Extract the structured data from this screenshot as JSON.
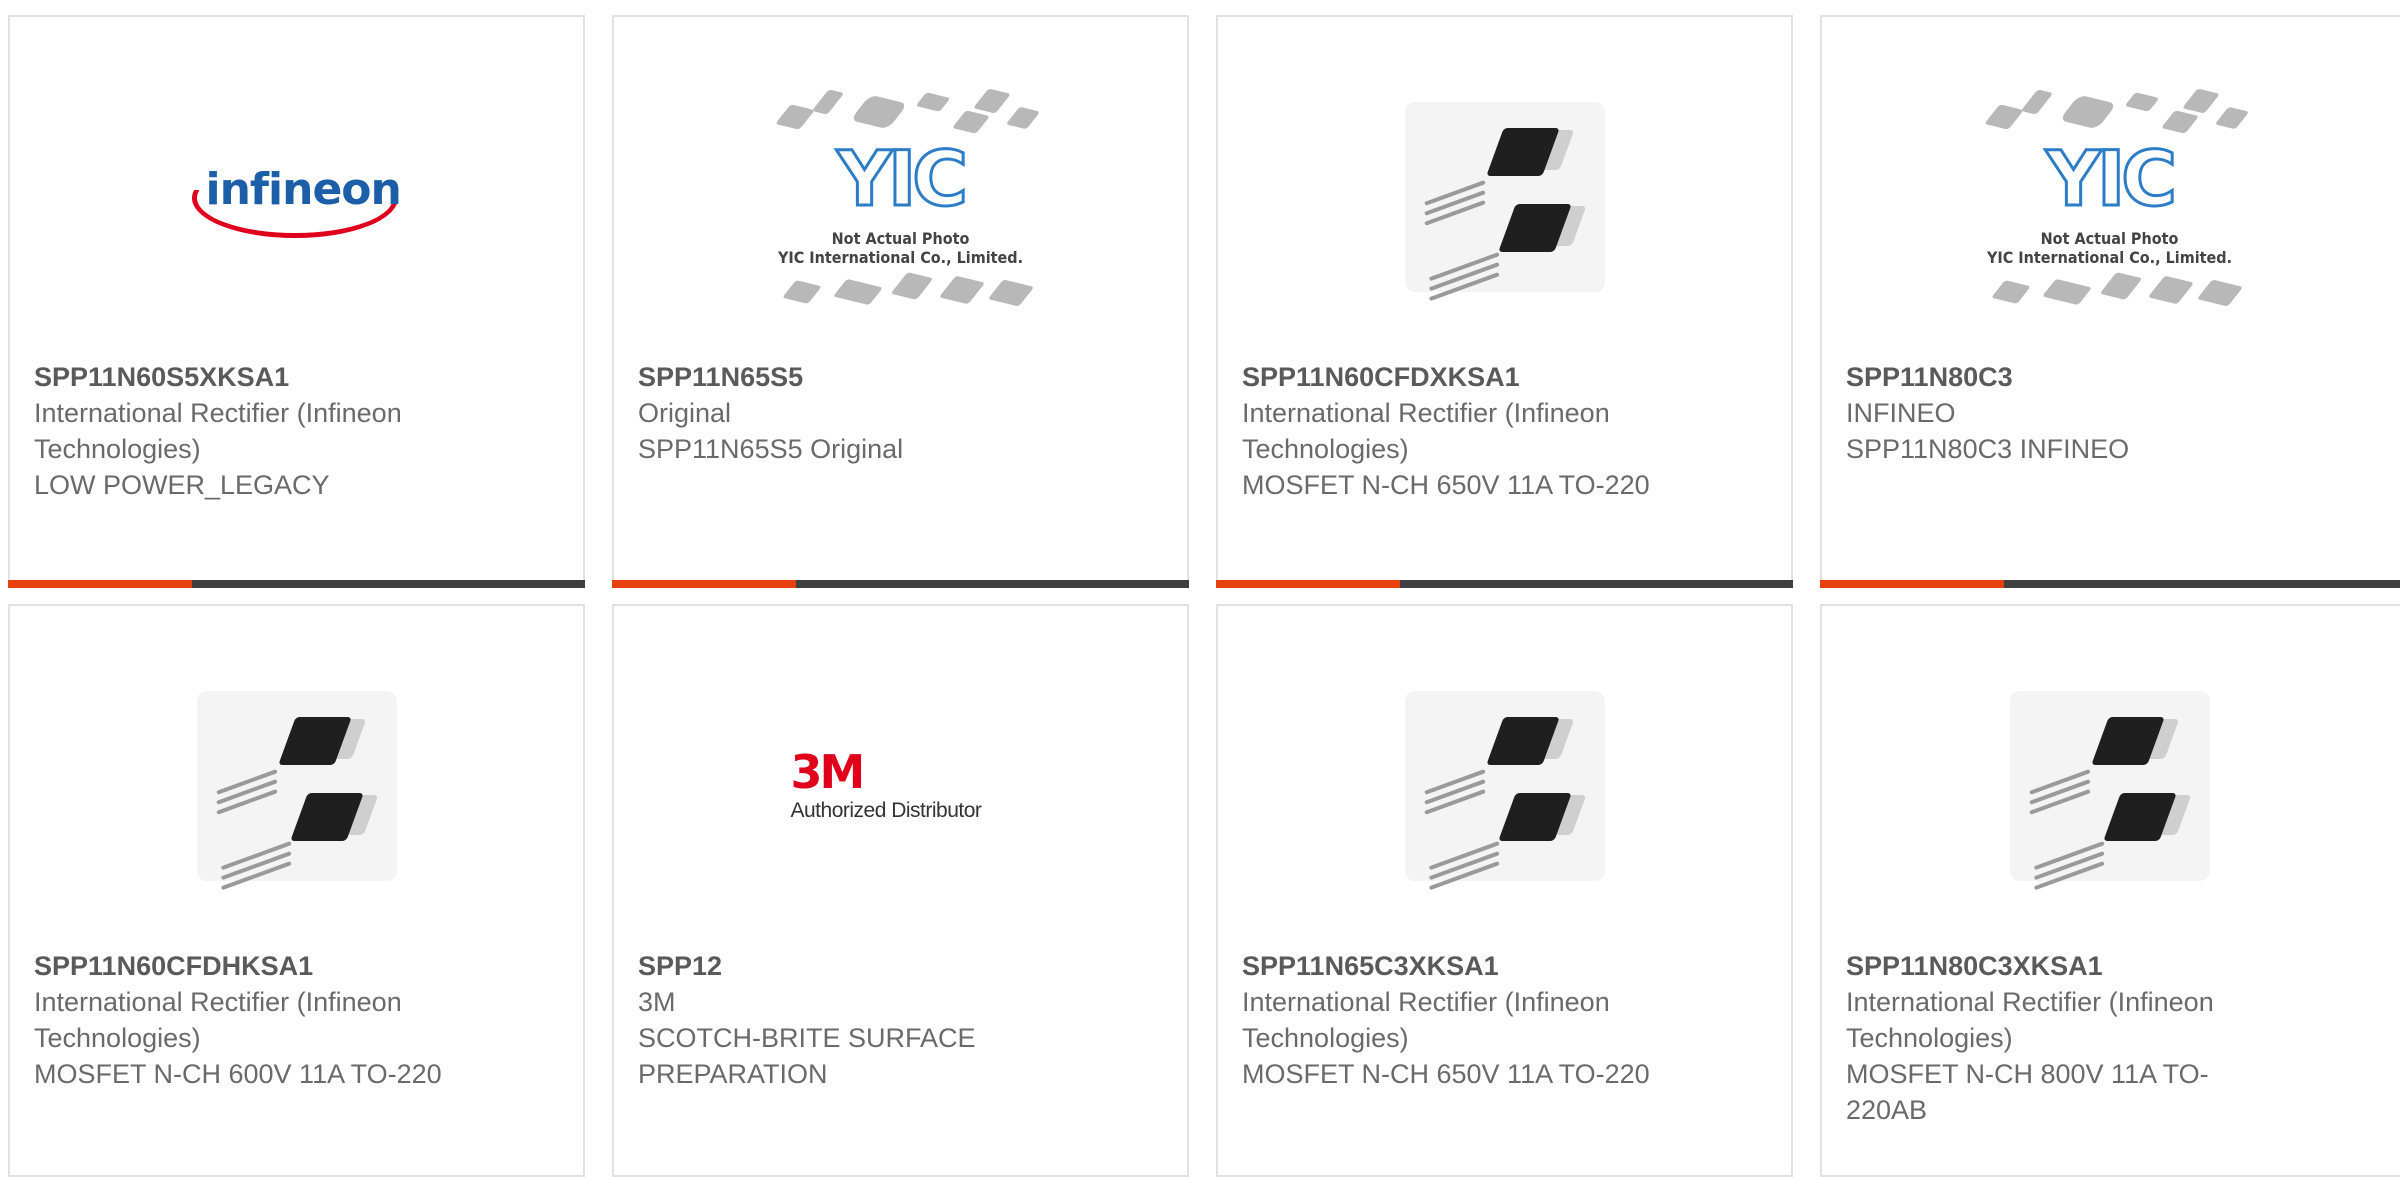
{
  "products": [
    {
      "part_number": "SPP11N60S5XKSA1",
      "manufacturer": "International Rectifier (Infineon Technologies)",
      "description": "LOW POWER_LEGACY",
      "image": "infineon-logo",
      "logo_text": "infineon"
    },
    {
      "part_number": "SPP11N65S5",
      "manufacturer": "Original",
      "description": "SPP11N65S5 Original",
      "image": "yic-placeholder",
      "placeholder_logo": "YIC",
      "placeholder_line1": "Not Actual Photo",
      "placeholder_line2": "YIC International Co., Limited."
    },
    {
      "part_number": "SPP11N60CFDXKSA1",
      "manufacturer": "International Rectifier (Infineon Technologies)",
      "description": "MOSFET N-CH 650V 11A TO-220",
      "image": "to220-transistor"
    },
    {
      "part_number": "SPP11N80C3",
      "manufacturer": "INFINEO",
      "description": "SPP11N80C3 INFINEO",
      "image": "yic-placeholder",
      "placeholder_logo": "YIC",
      "placeholder_line1": "Not Actual Photo",
      "placeholder_line2": "YIC International Co., Limited."
    },
    {
      "part_number": "SPP11N60CFDHKSA1",
      "manufacturer": "International Rectifier (Infineon Technologies)",
      "description": "MOSFET N-CH 600V 11A TO-220",
      "image": "to220-transistor"
    },
    {
      "part_number": "SPP12",
      "manufacturer": "3M",
      "description": "SCOTCH-BRITE SURFACE PREPARATION",
      "image": "3m-logo",
      "logo_mark": "3M",
      "logo_sub": "Authorized Distributor"
    },
    {
      "part_number": "SPP11N65C3XKSA1",
      "manufacturer": "International Rectifier (Infineon Technologies)",
      "description": "MOSFET N-CH 650V 11A TO-220",
      "image": "to220-transistor"
    },
    {
      "part_number": "SPP11N80C3XKSA1",
      "manufacturer": "International Rectifier (Infineon Technologies)",
      "description": "MOSFET N-CH 800V 11A TO-220AB",
      "image": "to220-transistor"
    }
  ],
  "colors": {
    "accent": "#e8400c",
    "bar": "#3f3f3f",
    "border": "#e2e2e2",
    "text": "#6a6a6a"
  }
}
